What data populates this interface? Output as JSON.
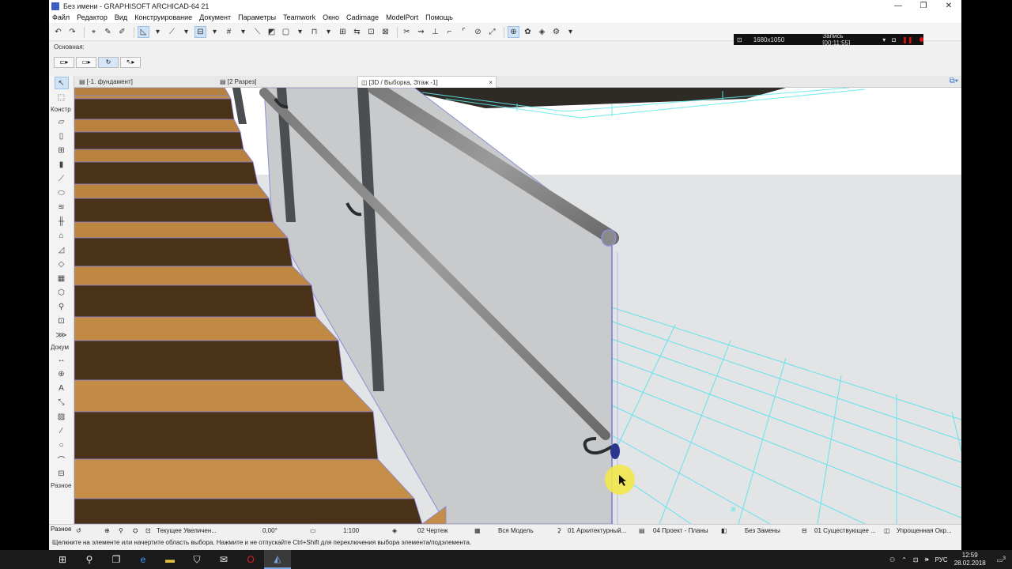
{
  "window": {
    "title": "Без имени - GRAPHISOFT ARCHICAD-64 21",
    "minimize": "—",
    "maximize": "❐",
    "close": "✕"
  },
  "menu": [
    "Файл",
    "Редактор",
    "Вид",
    "Конструирование",
    "Документ",
    "Параметры",
    "Teamwork",
    "Окно",
    "Cadimage",
    "ModelPort",
    "Помощь"
  ],
  "recorder": {
    "size": "1680x1050",
    "status": "Запись [00:11:55]"
  },
  "infobox": {
    "label": "Основная:"
  },
  "tabs": [
    {
      "label": "[-1. фундамент]"
    },
    {
      "label": "[2 Разрез]"
    },
    {
      "label": "[3D / Выборка, Этаж -1]",
      "close": "×"
    }
  ],
  "toolbox": {
    "group1": "Констр",
    "group2": "Докум",
    "group3": "Разное"
  },
  "status": {
    "zoom": "Текущее Увеличен...",
    "angle": "0,00°",
    "scale": "1:100",
    "layer_combo": "02 Чертеж",
    "model": "Вся Модель",
    "penset": "01 Архитектурный...",
    "model_view": "04 Проект - Планы",
    "override": "Без Замены",
    "renovation": "01 Существующее ...",
    "structure": "Упрощенная Окр..."
  },
  "hint": "Щелкните на элементе или начертите область выбора. Нажмите и не отпускайте Ctrl+Shift для переключения выбора элемента/подэлемента.",
  "taskbar": {
    "lang": "РУС",
    "time": "12:59",
    "date": "28.02.2018",
    "notif": "3"
  }
}
